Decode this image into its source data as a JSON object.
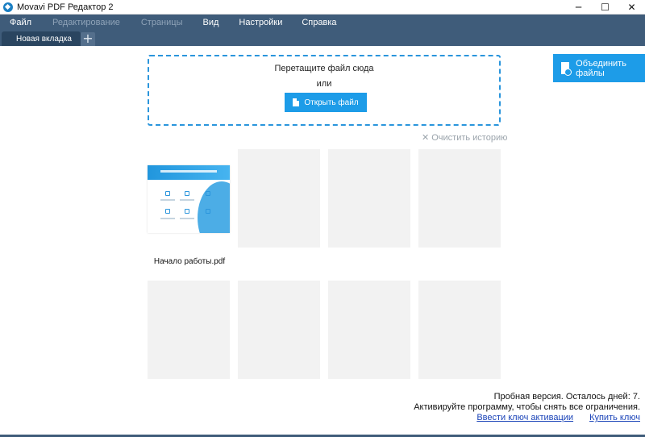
{
  "window": {
    "title": "Movavi PDF Редактор 2",
    "minimize": "─",
    "maximize": "☐",
    "close": "✕"
  },
  "menu": {
    "items": [
      {
        "label": "Файл",
        "enabled": true
      },
      {
        "label": "Редактирование",
        "enabled": false
      },
      {
        "label": "Страницы",
        "enabled": false
      },
      {
        "label": "Вид",
        "enabled": true
      },
      {
        "label": "Настройки",
        "enabled": true
      },
      {
        "label": "Справка",
        "enabled": true
      }
    ]
  },
  "tabs": {
    "active": "Новая вкладка",
    "add": "+"
  },
  "dropzone": {
    "title": "Перетащите файл сюда",
    "or": "или",
    "open_button": "Открыть файл"
  },
  "merge_button": "Объединить файлы",
  "history": {
    "clear_label": "Очистить историю",
    "clear_icon": "✕",
    "recent_files": [
      {
        "name": "Начало работы.pdf"
      }
    ],
    "empty_slots": 7
  },
  "footer": {
    "trial_line1": "Пробная версия. Осталось дней: 7.",
    "trial_line2": "Активируйте программу, чтобы снять все ограничения.",
    "enter_key": "Ввести ключ активации",
    "buy_key": "Купить ключ"
  },
  "colors": {
    "accent": "#1d9ce8",
    "menubar": "#3f5c7a",
    "link": "#1a43b8"
  }
}
